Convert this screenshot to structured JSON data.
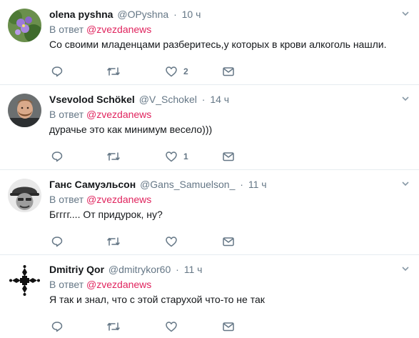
{
  "tweets": [
    {
      "fullname": "olena pyshna",
      "username": "@OPyshna",
      "time": "10 ч",
      "reply_prefix": "В ответ",
      "reply_mention": "@zvezdanews",
      "text": "Со своими младенцами разберитесь,у которых в крови алкоголь нашли.",
      "replies": "",
      "retweets": "",
      "likes": "2"
    },
    {
      "fullname": "Vsevolod Schökel",
      "username": "@V_Schokel",
      "time": "14 ч",
      "reply_prefix": "В ответ",
      "reply_mention": "@zvezdanews",
      "text": "дурачье это как минимум весело)))",
      "replies": "",
      "retweets": "",
      "likes": "1"
    },
    {
      "fullname": "Ганс Самуэльсон",
      "username": "@Gans_Samuelson_",
      "time": "11 ч",
      "reply_prefix": "В ответ",
      "reply_mention": "@zvezdanews",
      "text": "Бгггг.... От придурок, ну?",
      "replies": "",
      "retweets": "",
      "likes": ""
    },
    {
      "fullname": "Dmitriy Qor",
      "username": "@dmitrykor60",
      "time": "11 ч",
      "reply_prefix": "В ответ",
      "reply_mention": "@zvezdanews",
      "text": "Я так и знал, что с этой старухой что-то не так",
      "replies": "",
      "retweets": "",
      "likes": ""
    }
  ],
  "icons": {
    "reply": "reply-icon",
    "retweet": "retweet-icon",
    "like": "heart-icon",
    "message": "envelope-icon",
    "caret": "chevron-down-icon"
  },
  "colors": {
    "mention": "#e0245e",
    "secondary_text": "#657786",
    "action_icon": "#657786",
    "divider": "#e6ecf0"
  }
}
